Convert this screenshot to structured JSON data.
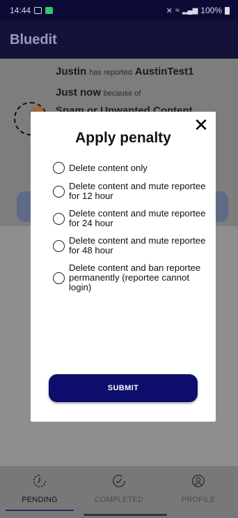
{
  "status_bar": {
    "time": "14:44",
    "battery": "100%"
  },
  "header": {
    "title": "Bluedit"
  },
  "report": {
    "reporter": "Justin",
    "has_reported_text": "has reported",
    "reported_user": "AustinTest1",
    "time": "Just now",
    "because_text": "because of",
    "reason": "Spam or Unwanted Content"
  },
  "modal": {
    "title": "Apply penalty",
    "close_label": "✕",
    "options": [
      {
        "label": "Delete content only"
      },
      {
        "label": "Delete content and mute reportee for 12 hour"
      },
      {
        "label": "Delete content and mute reportee for 24 hour"
      },
      {
        "label": "Delete content and mute reportee for 48 hour"
      },
      {
        "label": "Delete content and ban reportee permanently (reportee cannot login)"
      }
    ],
    "submit_label": "SUBMIT"
  },
  "bottom_nav": {
    "items": [
      {
        "label": "PENDING",
        "icon": "clock-refresh-icon"
      },
      {
        "label": "COMPLETED",
        "icon": "check-circle-icon"
      },
      {
        "label": "PROFILE",
        "icon": "profile-icon"
      }
    ]
  },
  "colors": {
    "header_bg": "#13133a",
    "submit_bg": "#0d0d6b",
    "modal_bg": "#ffffff"
  }
}
